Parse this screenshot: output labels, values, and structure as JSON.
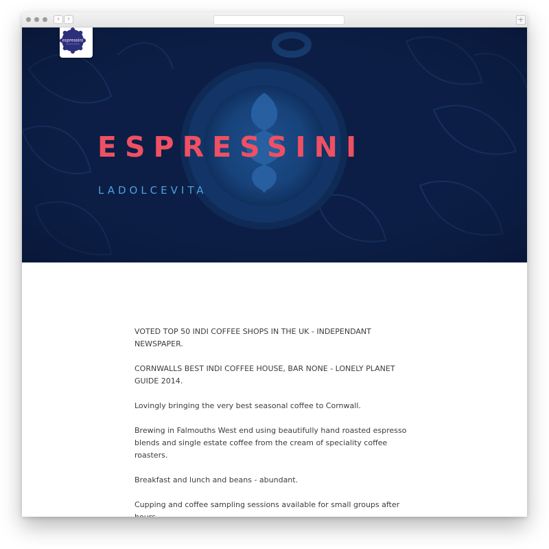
{
  "browser": {
    "nav_back": "‹",
    "nav_forward": "›",
    "new_tab": "+"
  },
  "hero": {
    "logo_text": "espressini",
    "title": "ESPRESSINI",
    "subtitle": "LADOLCEVITA"
  },
  "content": {
    "paragraphs": [
      "VOTED TOP 50 INDI COFFEE SHOPS IN THE UK - INDEPENDANT NEWSPAPER.",
      "CORNWALLS BEST INDI COFFEE HOUSE, BAR NONE - LONELY PLANET GUIDE 2014.",
      "Lovingly bringing the very best seasonal coffee to Cornwall.",
      "Brewing in Falmouths West end using beautifully hand roasted espresso blends and single estate coffee from the cream of speciality coffee roasters.",
      "Breakfast and lunch and beans - abundant.",
      "Cupping and coffee sampling sessions available for small groups after hours."
    ]
  },
  "colors": {
    "hero_bg": "#0c1e45",
    "title": "#ef5063",
    "subtitle": "#4aa2e0",
    "logo": "#2c2f7a"
  }
}
